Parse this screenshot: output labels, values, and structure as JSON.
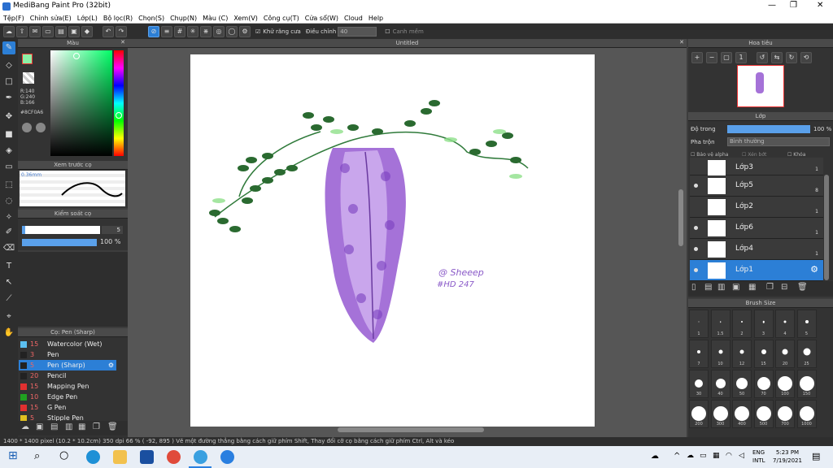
{
  "app": {
    "title": "MediBang Paint Pro (32bit)"
  },
  "menu": [
    "Tệp(F)",
    "Chỉnh sửa(E)",
    "Lớp(L)",
    "Bộ lọc(R)",
    "Chọn(S)",
    "Chụp(N)",
    "Màu (C)",
    "Xem(V)",
    "Công cụ(T)",
    "Cửa sổ(W)",
    "Cloud",
    "Help"
  ],
  "toolbar": {
    "antialias_label": "Khử răng cưa",
    "adjust_label": "Điều chỉnh",
    "adjust_value": "40",
    "snap_label": "Canh mềm"
  },
  "color_panel": {
    "title": "Màu",
    "r": "R:140",
    "g": "G:240",
    "b": "B:166",
    "hex": "#8CF0A6",
    "fg": "#8cf0a6"
  },
  "preview_panel": {
    "title": "Xem trước cọ",
    "size": "0.36mm"
  },
  "brush_ctrl": {
    "title": "Kiểm soát cọ",
    "size": "5",
    "opacity": "100 %",
    "opacity_pct": 100
  },
  "brush_list": {
    "title": "Cọ: Pen (Sharp)",
    "items": [
      {
        "size": "15",
        "name": "Watercolor (Wet)",
        "color": "#5bc0f0"
      },
      {
        "size": "3",
        "name": "Pen",
        "color": "#222222"
      },
      {
        "size": "5",
        "name": "Pen (Sharp)",
        "color": "#222222"
      },
      {
        "size": "20",
        "name": "Pencil",
        "color": "#222222"
      },
      {
        "size": "15",
        "name": "Mapping Pen",
        "color": "#e03030"
      },
      {
        "size": "10",
        "name": "Edge Pen",
        "color": "#20a020"
      },
      {
        "size": "15",
        "name": "G Pen",
        "color": "#e03030"
      },
      {
        "size": "5",
        "name": "Stipple Pen",
        "color": "#e0c020"
      }
    ]
  },
  "canvas": {
    "tab": "Untitled",
    "signature": "@ Sheeep",
    "tag": "#HD 247"
  },
  "navigator": {
    "title": "Hoa tiêu"
  },
  "layers": {
    "title": "Lớp",
    "opacity_label": "Độ trong",
    "opacity_value": "100 %",
    "opacity_pct": 100,
    "blend_label": "Pha trộn",
    "blend_value": "Bình thường",
    "protect_alpha": "Bảo vệ alpha",
    "clip": "Xén bớt",
    "lock": "Khóa",
    "items": [
      {
        "name": "Lớp3",
        "opa": "1"
      },
      {
        "name": "Lớp5",
        "opa": "8"
      },
      {
        "name": "Lớp2",
        "opa": "1"
      },
      {
        "name": "Lớp6",
        "opa": "1"
      },
      {
        "name": "Lớp4",
        "opa": "1"
      },
      {
        "name": "Lớp1",
        "opa": ""
      }
    ]
  },
  "brush_size": {
    "title": "Brush Size",
    "sizes": [
      "1",
      "1.5",
      "2",
      "3",
      "4",
      "5",
      "7",
      "10",
      "12",
      "15",
      "20",
      "25",
      "30",
      "40",
      "50",
      "70",
      "100",
      "150",
      "200",
      "300",
      "400",
      "500",
      "700",
      "1000"
    ]
  },
  "status": {
    "dims": "1400 * 1400 pixel",
    "cm": "(10.2 * 10.2cm)",
    "dpi": "350 dpi",
    "zoom": "66 %",
    "coords": "( -92, 895 )",
    "hint": "Vẽ một đường thẳng bằng cách giữ phím Shift, Thay đổi cỡ cọ bằng cách giữ phím Ctrl, Alt và kéo"
  },
  "taskbar": {
    "lang1": "ENG",
    "lang2": "INTL",
    "time": "5:23 PM",
    "date": "7/19/2021"
  }
}
